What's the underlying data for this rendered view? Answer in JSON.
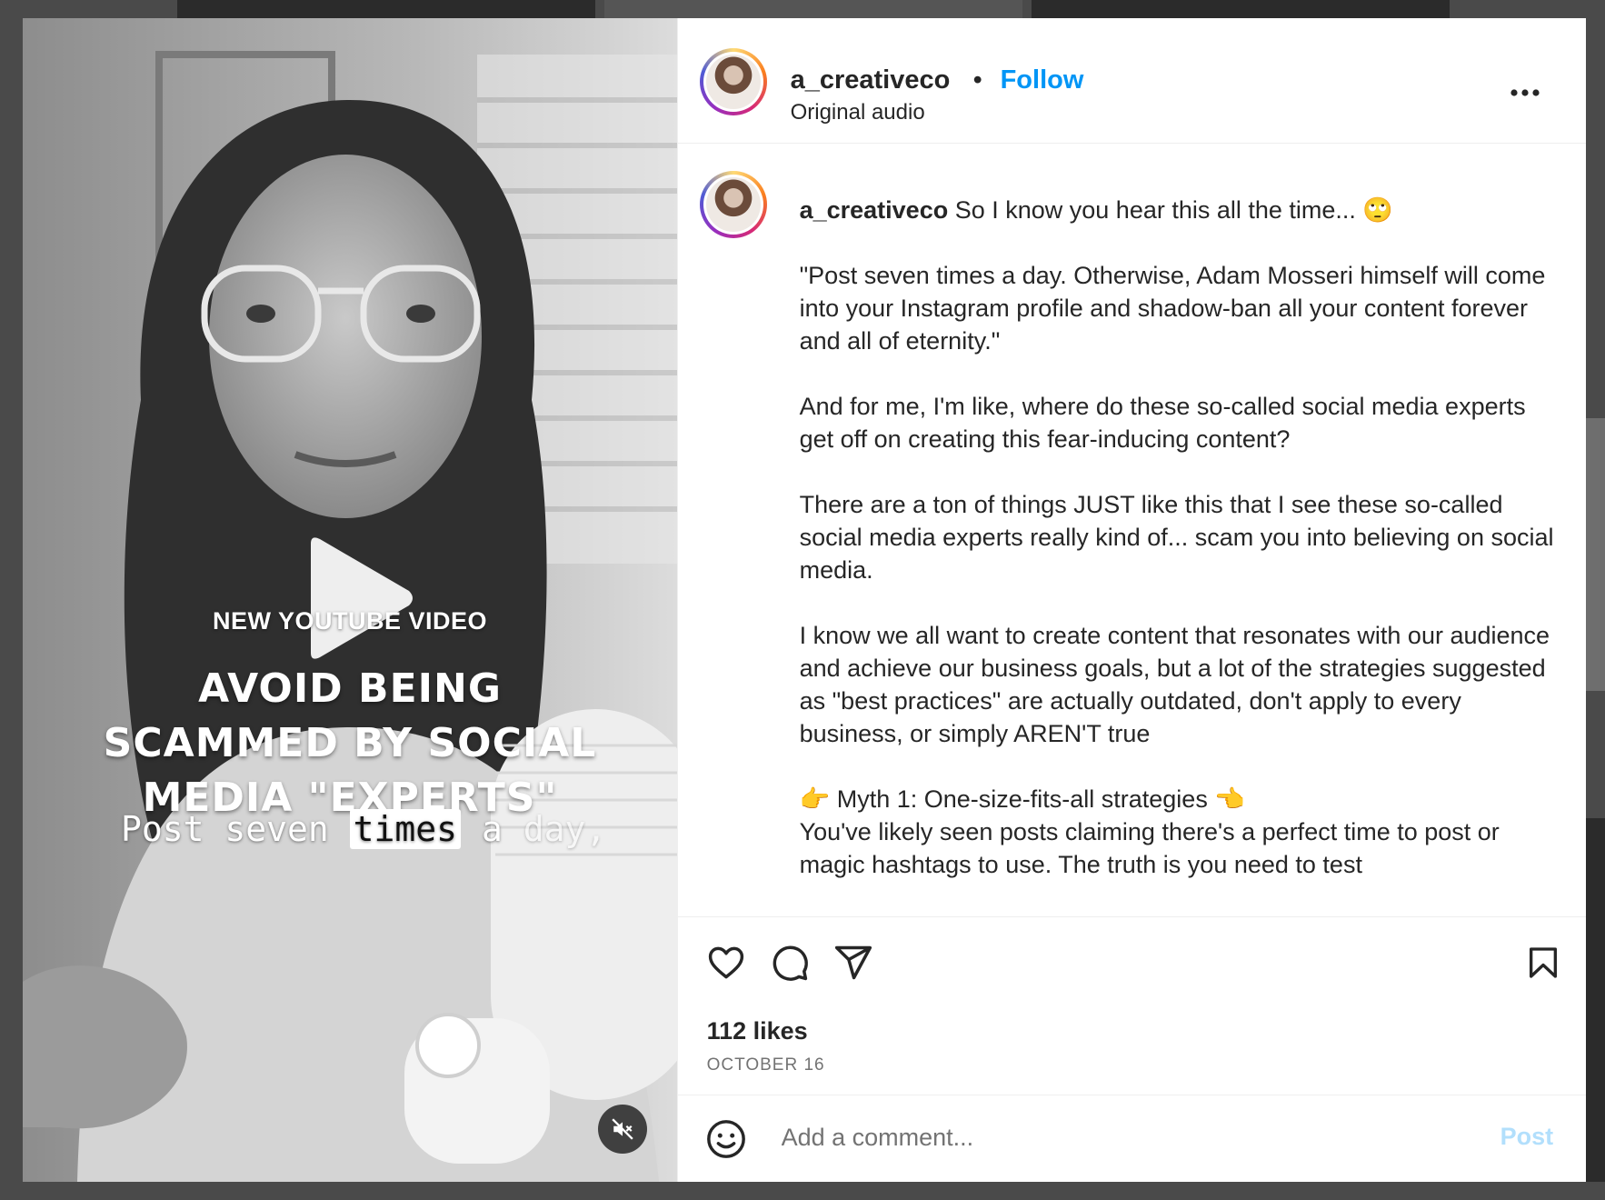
{
  "post": {
    "username": "a_creativeco",
    "separator": "•",
    "follow_label": "Follow",
    "audio_label": "Original audio"
  },
  "video": {
    "overlay_subtitle": "NEW YOUTUBE VIDEO",
    "overlay_title": "Avoid being scammed by social media \"experts\"",
    "caption_part1": "Post seven ",
    "caption_highlight": "times",
    "caption_part2": " a ",
    "caption_part3": "day,"
  },
  "caption": {
    "username": "a_creativeco",
    "first_line": " So I know you hear this all the time... 🙄",
    "paragraphs": [
      "\"Post seven times a day. Otherwise, Adam Mosseri himself will come into your Instagram profile and shadow-ban all your content forever and all of eternity.\"",
      "And for me, I'm like, where do these so-called social media experts get off on creating this fear-inducing content?",
      "There are a ton of things JUST like this that I see these so-called social media experts really kind of... scam you into believing on social media.",
      "I know we all want to create content that resonates with our audience and achieve our business goals, but a lot of the strategies suggested as \"best practices\" are actually outdated, don't apply to every business, or simply AREN'T true"
    ],
    "myth_heading": "👉 Myth 1: One-size-fits-all strategies 👈",
    "myth_text": "You've likely seen posts claiming there's a perfect time to post or magic hashtags to use. The truth is you need to test"
  },
  "stats": {
    "likes": "112 likes",
    "date": "OCTOBER 16"
  },
  "comment": {
    "placeholder": "Add a comment...",
    "post_label": "Post"
  },
  "icons": [
    "heart-icon",
    "comment-icon",
    "share-icon",
    "bookmark-icon",
    "more-icon",
    "emoji-icon",
    "mute-icon",
    "play-icon"
  ],
  "colors": {
    "follow_blue": "#0095f6",
    "post_disabled": "#b2dffc",
    "text": "#262626",
    "muted": "#737373"
  }
}
